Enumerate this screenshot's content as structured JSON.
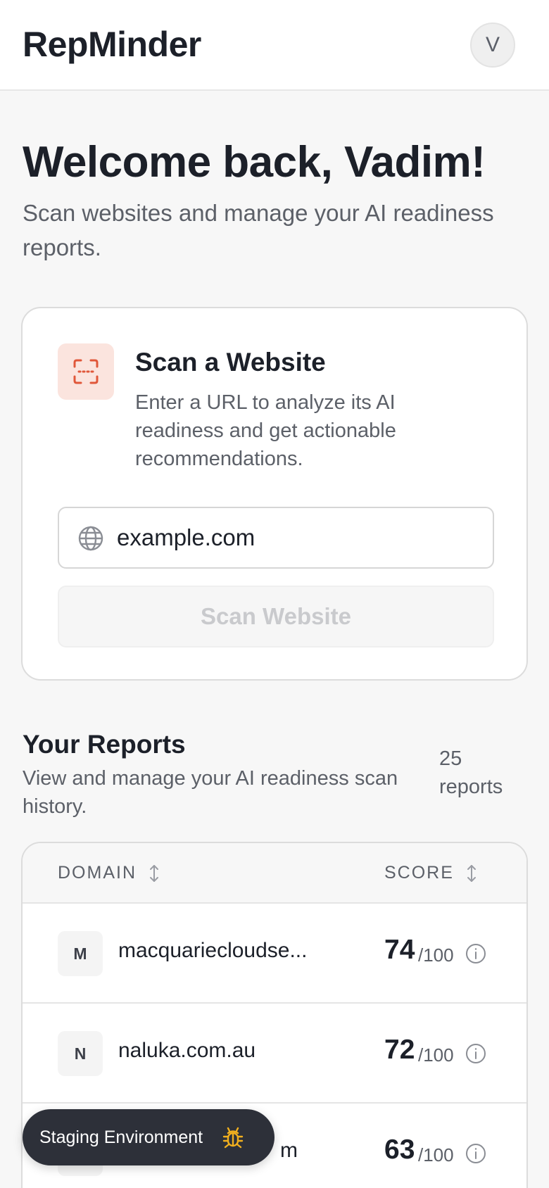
{
  "header": {
    "brand": "RepMinder",
    "avatar_initial": "V"
  },
  "welcome": {
    "title": "Welcome back, Vadim!",
    "subtitle": "Scan websites and manage your AI readiness reports."
  },
  "scan": {
    "icon": "scan-frame-icon",
    "title": "Scan a Website",
    "description": "Enter a URL to analyze its AI readiness and get actionable recommendations.",
    "input_placeholder": "example.com",
    "input_value": "",
    "button_label": "Scan Website",
    "button_disabled": true
  },
  "reports": {
    "title": "Your Reports",
    "subtitle": "View and manage your AI readiness scan history.",
    "count_label": "25 reports",
    "columns": {
      "domain": "DOMAIN",
      "score": "SCORE"
    },
    "rows": [
      {
        "initial": "M",
        "domain": "macquariecloudse...",
        "score": "74",
        "max": "/100"
      },
      {
        "initial": "N",
        "domain": "naluka.com.au",
        "score": "72",
        "max": "/100"
      },
      {
        "initial": "",
        "domain": "m",
        "score": "63",
        "max": "/100"
      }
    ]
  },
  "toast": {
    "label": "Staging Environment",
    "icon": "bug-icon"
  },
  "colors": {
    "accent": "#e0573a",
    "accent_bg": "#fbe4de",
    "text": "#1c2029",
    "muted": "#5c6068",
    "toast_bg": "#2d3039",
    "bug_icon": "#f2b01e"
  }
}
